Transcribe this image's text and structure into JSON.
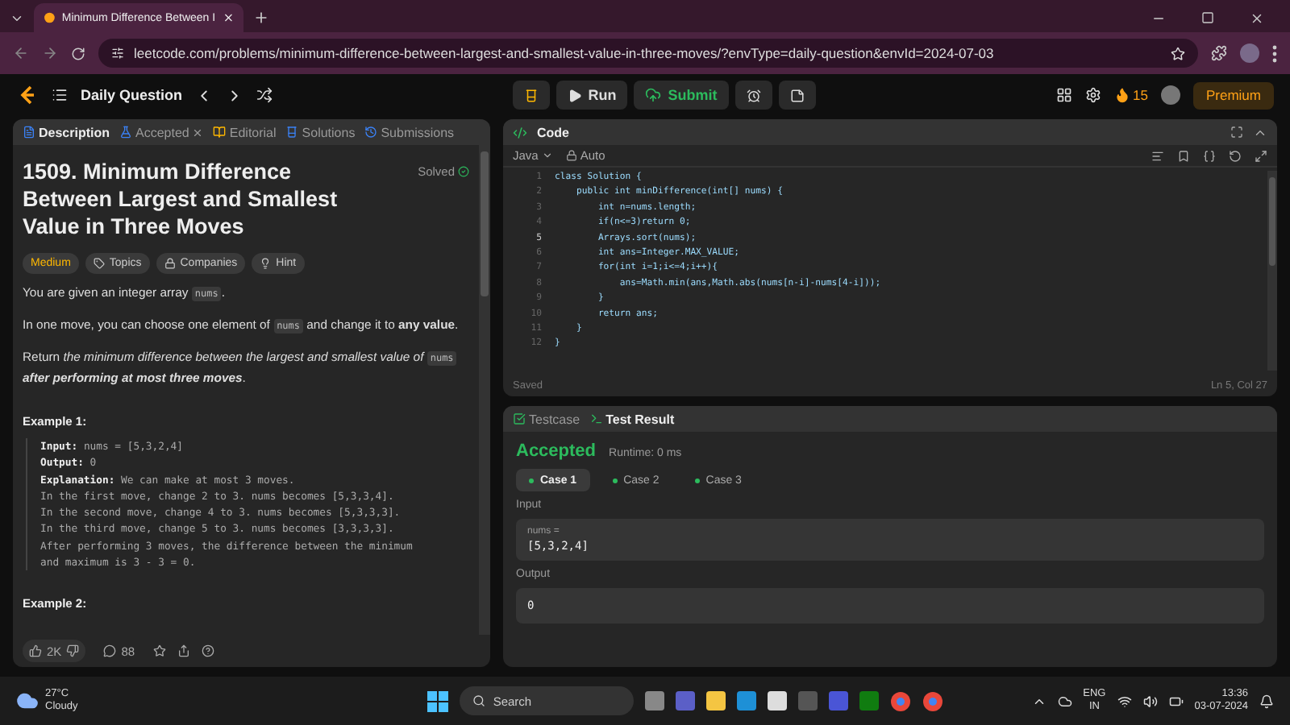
{
  "browser": {
    "tab_title": "Minimum Difference Between I",
    "url": "leetcode.com/problems/minimum-difference-between-largest-and-smallest-value-in-three-moves/?envType=daily-question&envId=2024-07-03"
  },
  "header": {
    "title": "Daily Question",
    "run": "Run",
    "submit": "Submit",
    "streak": "15",
    "premium": "Premium"
  },
  "left_tabs": [
    {
      "label": "Description",
      "selected": true,
      "closable": false
    },
    {
      "label": "Accepted",
      "selected": false,
      "closable": true
    },
    {
      "label": "Editorial",
      "selected": false,
      "closable": false
    },
    {
      "label": "Solutions",
      "selected": false,
      "closable": false
    },
    {
      "label": "Submissions",
      "selected": false,
      "closable": false
    }
  ],
  "problem": {
    "title": "1509. Minimum Difference Between Largest and Smallest Value in Three Moves",
    "status": "Solved",
    "tags": [
      {
        "label": "Medium",
        "kind": "difficulty"
      },
      {
        "label": "Topics",
        "kind": "topics"
      },
      {
        "label": "Companies",
        "kind": "companies"
      },
      {
        "label": "Hint",
        "kind": "hint"
      }
    ],
    "paragraphs": [
      [
        {
          "text": "You are given an integer array ",
          "kind": "text"
        },
        {
          "text": "nums",
          "kind": "code"
        },
        {
          "text": ".",
          "kind": "text"
        }
      ],
      [
        {
          "text": "In one move, you can choose one element of ",
          "kind": "text"
        },
        {
          "text": "nums",
          "kind": "code"
        },
        {
          "text": " and change it to ",
          "kind": "text"
        },
        {
          "text": "any value",
          "kind": "bold"
        },
        {
          "text": ".",
          "kind": "text"
        }
      ],
      [
        {
          "text": "Return ",
          "kind": "text"
        },
        {
          "text": "the minimum difference between the largest and smallest value of ",
          "kind": "italic"
        },
        {
          "text": "nums",
          "kind": "code"
        },
        {
          "text": " after performing at most three moves",
          "kind": "bolditalic"
        },
        {
          "text": ".",
          "kind": "text"
        }
      ]
    ],
    "examples": [
      {
        "title": "Example 1:",
        "lines": [
          {
            "label": "Input:",
            "text": " nums = [5,3,2,4]"
          },
          {
            "label": "Output:",
            "text": " 0"
          },
          {
            "label": "Explanation:",
            "text": " We can make at most 3 moves."
          },
          {
            "text": "In the first move, change 2 to 3. nums becomes [5,3,3,4]."
          },
          {
            "text": "In the second move, change 4 to 3. nums becomes [5,3,3,3]."
          },
          {
            "text": "In the third move, change 5 to 3. nums becomes [3,3,3,3]."
          },
          {
            "text": "After performing 3 moves, the difference between the minimum"
          },
          {
            "text": "and maximum is 3 - 3 = 0."
          }
        ]
      },
      {
        "title": "Example 2:"
      }
    ]
  },
  "footer": {
    "likes": "2K",
    "comments": "88"
  },
  "code": {
    "title": "Code",
    "language": "Java",
    "mode": "Auto",
    "status": "Saved",
    "cursor": "Ln 5, Col 27",
    "lines": [
      {
        "number": "1",
        "text": "class Solution {"
      },
      {
        "number": "2",
        "text": "    public int minDifference(int[] nums) {"
      },
      {
        "number": "3",
        "text": "        int n=nums.length;"
      },
      {
        "number": "4",
        "text": "        if(n<=3)return 0;"
      },
      {
        "number": "5",
        "text": "        Arrays.sort(nums);"
      },
      {
        "number": "6",
        "text": "        int ans=Integer.MAX_VALUE;"
      },
      {
        "number": "7",
        "text": "        for(int i=1;i<=4;i++){"
      },
      {
        "number": "8",
        "text": "            ans=Math.min(ans,Math.abs(nums[n-i]-nums[4-i]));"
      },
      {
        "number": "9",
        "text": "        }"
      },
      {
        "number": "10",
        "text": "        return ans;"
      },
      {
        "number": "11",
        "text": "    }"
      },
      {
        "number": "12",
        "text": "}"
      }
    ]
  },
  "result": {
    "tabs": [
      {
        "label": "Testcase",
        "selected": false
      },
      {
        "label": "Test Result",
        "selected": true
      }
    ],
    "verdict": "Accepted",
    "runtime": "Runtime: 0 ms",
    "cases": [
      {
        "label": "Case 1",
        "selected": true
      },
      {
        "label": "Case 2",
        "selected": false
      },
      {
        "label": "Case 3",
        "selected": false
      }
    ],
    "input_label": "Input",
    "param": "nums =",
    "input_value": "[5,3,2,4]",
    "output_label": "Output",
    "output_value": "0"
  },
  "taskbar": {
    "temperature": "27°C",
    "weather": "Cloudy",
    "search": "Search",
    "language": "ENG",
    "region": "IN",
    "time": "13:36",
    "date": "03-07-2024"
  }
}
